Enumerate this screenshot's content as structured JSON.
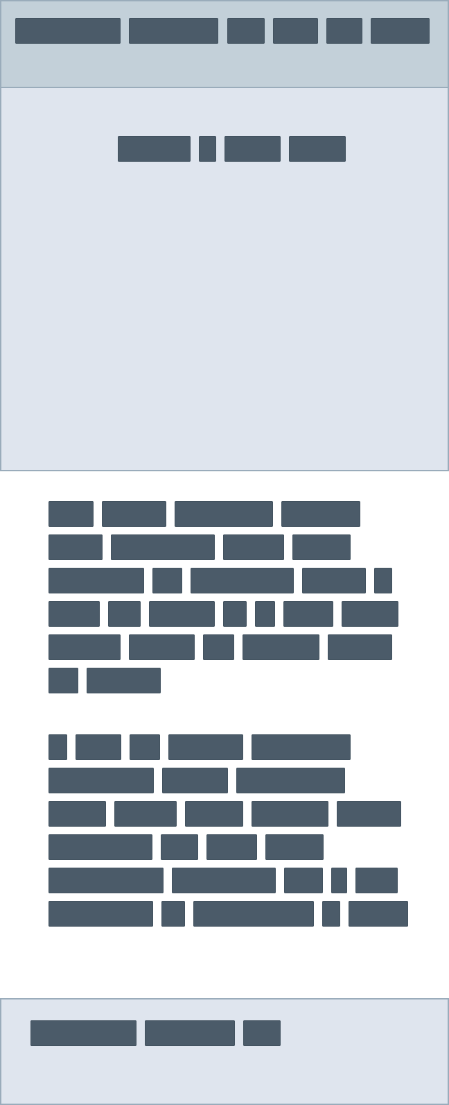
{
  "colors": {
    "page_background": "#ffffff",
    "nav_background": "#c3d0d9",
    "panel_background": "#dfe5ee",
    "border": "#9aacbb",
    "placeholder_block": "#4b5b69"
  },
  "top_nav": {
    "item_count": 6
  },
  "hero": {
    "heading_word_count": 4
  },
  "article": {
    "paragraph_count": 2,
    "paragraphs": [
      {
        "line_count": 6,
        "words_per_line": [
          4,
          4,
          5,
          7,
          5,
          2
        ]
      },
      {
        "line_count": 6,
        "words_per_line": [
          5,
          3,
          5,
          4,
          5,
          5
        ]
      }
    ]
  },
  "footer": {
    "item_count": 3
  }
}
